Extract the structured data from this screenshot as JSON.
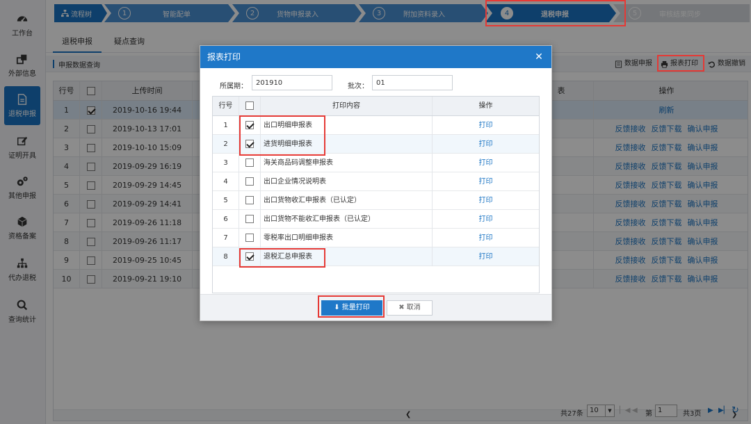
{
  "sidebar": {
    "items": [
      {
        "label": "工作台",
        "icon": "dashboard-icon"
      },
      {
        "label": "外部信息",
        "icon": "external-link-icon"
      },
      {
        "label": "退税申报",
        "icon": "document-icon",
        "active": true
      },
      {
        "label": "证明开具",
        "icon": "edit-icon"
      },
      {
        "label": "其他申报",
        "icon": "gears-icon"
      },
      {
        "label": "资格备案",
        "icon": "box-icon"
      },
      {
        "label": "代办退税",
        "icon": "org-chart-icon"
      },
      {
        "label": "查询统计",
        "icon": "search-icon"
      }
    ]
  },
  "flow": {
    "root_label": "流程树",
    "steps": [
      {
        "num": "1",
        "label": "智能配单"
      },
      {
        "num": "2",
        "label": "货物申报录入"
      },
      {
        "num": "3",
        "label": "附加资料录入"
      },
      {
        "num": "4",
        "label": "退税申报",
        "active": true
      },
      {
        "num": "5",
        "label": "审核结果同步"
      }
    ]
  },
  "tabs": [
    {
      "label": "退税申报",
      "active": true
    },
    {
      "label": "疑点查询"
    }
  ],
  "toolbar": {
    "section_title": "申报数据查询",
    "data_declare": "数据申报",
    "report_print": "报表打印",
    "data_revoke": "数据撤销"
  },
  "grid": {
    "headers": {
      "row_no": "行号",
      "upload_time": "上传时间",
      "partial": "表",
      "actions": "操作"
    },
    "rows": [
      {
        "no": "1",
        "checked": true,
        "time": "2019-10-16 19:44",
        "actions": [
          "刷新"
        ]
      },
      {
        "no": "2",
        "checked": false,
        "time": "2019-10-13 17:01",
        "actions": [
          "反馈接收",
          "反馈下载",
          "确认申报"
        ]
      },
      {
        "no": "3",
        "checked": false,
        "time": "2019-10-10 15:09",
        "actions": [
          "反馈接收",
          "反馈下载",
          "确认申报"
        ]
      },
      {
        "no": "4",
        "checked": false,
        "time": "2019-09-29 16:19",
        "actions": [
          "反馈接收",
          "反馈下载",
          "确认申报"
        ]
      },
      {
        "no": "5",
        "checked": false,
        "time": "2019-09-29 14:45",
        "actions": [
          "反馈接收",
          "反馈下载",
          "确认申报"
        ]
      },
      {
        "no": "6",
        "checked": false,
        "time": "2019-09-29 14:41",
        "actions": [
          "反馈接收",
          "反馈下载",
          "确认申报"
        ]
      },
      {
        "no": "7",
        "checked": false,
        "time": "2019-09-26 11:18",
        "actions": [
          "反馈接收",
          "反馈下载",
          "确认申报"
        ]
      },
      {
        "no": "8",
        "checked": false,
        "time": "2019-09-26 11:17",
        "actions": [
          "反馈接收",
          "反馈下载",
          "确认申报"
        ]
      },
      {
        "no": "9",
        "checked": false,
        "time": "2019-09-25 10:45",
        "actions": [
          "反馈接收",
          "反馈下载",
          "确认申报"
        ]
      },
      {
        "no": "10",
        "checked": false,
        "time": "2019-09-21 19:10",
        "actions": [
          "反馈接收",
          "反馈下载",
          "确认申报"
        ]
      }
    ]
  },
  "pager": {
    "total": "共27条",
    "page_size": "10",
    "page_prefix": "第",
    "page_value": "1",
    "page_total": "共3页"
  },
  "dialog": {
    "title": "报表打印",
    "period_label": "所属期：",
    "period_value": "201910",
    "batch_label": "批次：",
    "batch_value": "01",
    "headers": {
      "row_no": "行号",
      "content": "打印内容",
      "action": "操作"
    },
    "rows": [
      {
        "no": "1",
        "checked": true,
        "content": "出口明细申报表",
        "action": "打印"
      },
      {
        "no": "2",
        "checked": true,
        "content": "进货明细申报表",
        "action": "打印"
      },
      {
        "no": "3",
        "checked": false,
        "content": "海关商品码调整申报表",
        "action": "打印"
      },
      {
        "no": "4",
        "checked": false,
        "content": "出口企业情况说明表",
        "action": "打印"
      },
      {
        "no": "5",
        "checked": false,
        "content": "出口货物收汇申报表（已认定）",
        "action": "打印"
      },
      {
        "no": "6",
        "checked": false,
        "content": "出口货物不能收汇申报表（已认定）",
        "action": "打印"
      },
      {
        "no": "7",
        "checked": false,
        "content": "零税率出口明细申报表",
        "action": "打印"
      },
      {
        "no": "8",
        "checked": true,
        "content": "退税汇总申报表",
        "action": "打印"
      }
    ],
    "batch_print": "批量打印",
    "cancel": "取消"
  },
  "colors": {
    "primary": "#1a74c4",
    "highlight": "#e53935",
    "dialog_header": "#1f78c8"
  }
}
